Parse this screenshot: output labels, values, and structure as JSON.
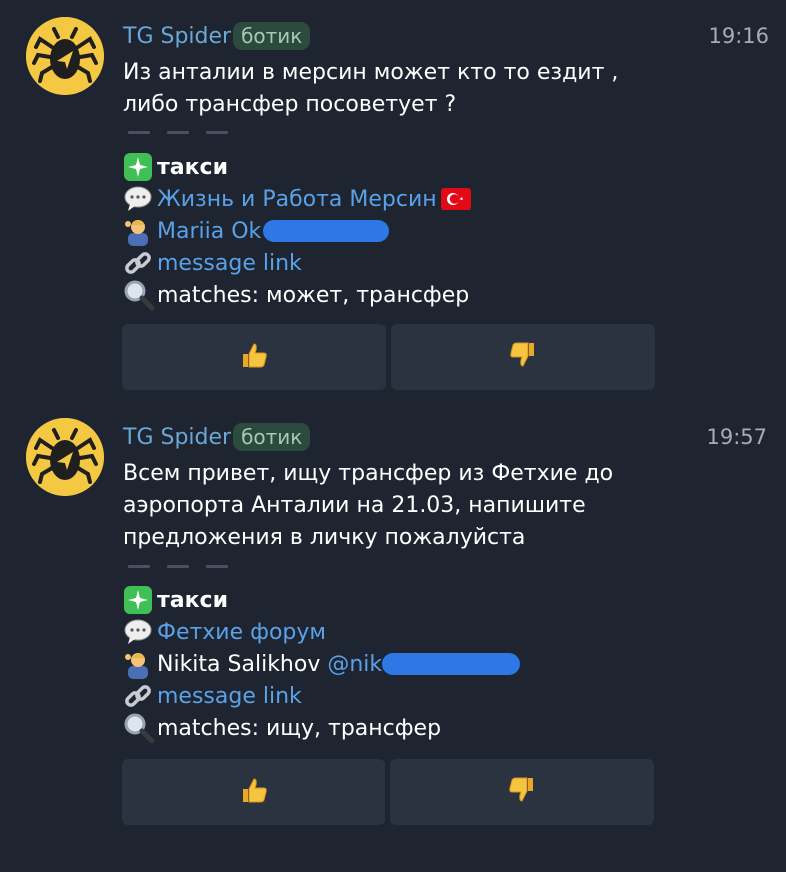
{
  "messages": [
    {
      "sender": "TG Spider",
      "badge": "ботик",
      "time": "19:16",
      "text": "Из анталии в мерсин может кто то ездит ,\nлибо трансфер посоветует ?",
      "category": "такси",
      "chat": "Жизнь и Работа Мерсин",
      "author_name": "Mariia Ok",
      "author_handle": "",
      "link_label": "message link",
      "matches": "matches: может, трансфер"
    },
    {
      "sender": "TG Spider",
      "badge": "ботик",
      "time": "19:57",
      "text": "Всем привет, ищу трансфер из Фетхие до\nаэропорта Анталии на 21.03, напишите\nпредложения в личку пожалуйста",
      "category": "такси",
      "chat": "Фетхие форум",
      "author_name": "Nikita Salikhov ",
      "author_handle": "@nik",
      "link_label": "message link",
      "matches": "matches: ищу, трансфер"
    }
  ],
  "colors": {
    "background": "#1e2530",
    "sender": "#6aa8d6",
    "link": "#5aa1ea",
    "button": "#2c3340",
    "avatar": "#f5c843",
    "redaction": "#2d78e6"
  },
  "icons": [
    "spider-bot-avatar",
    "sparkle-check-icon",
    "speech-bubble-icon",
    "turkey-flag-icon",
    "person-icon",
    "chain-link-icon",
    "magnifier-icon",
    "thumbs-up-icon",
    "thumbs-down-icon"
  ]
}
